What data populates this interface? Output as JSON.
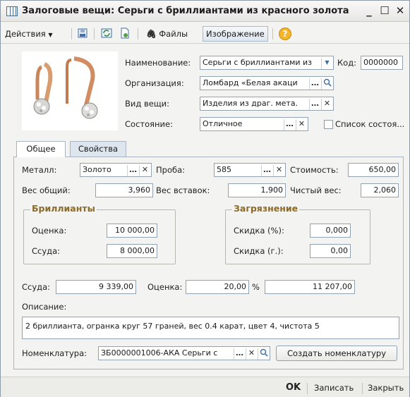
{
  "window": {
    "title": "Залоговые вещи: Серьги с бриллиантами из красного золота",
    "min_label": "_",
    "max_label": "☐",
    "close_label": "✕"
  },
  "toolbar": {
    "actions_label": "Действия",
    "files_label": "Файлы",
    "image_label": "Изображение",
    "help_label": "?"
  },
  "header": {
    "name_label": "Наименование:",
    "name_value": "Серьги с бриллиантами из",
    "code_label": "Код:",
    "code_value": "0000000",
    "org_label": "Организация:",
    "org_value": "Ломбард «Белая акаци",
    "kind_label": "Вид вещи:",
    "kind_value": "Изделия из драг. мета.",
    "state_label": "Состояние:",
    "state_value": "Отличное",
    "state_list_label": "Список состоя..."
  },
  "tabs": [
    {
      "label": "Общее"
    },
    {
      "label": "Свойства"
    }
  ],
  "general": {
    "metal_label": "Металл:",
    "metal_value": "Золото",
    "probe_label": "Проба:",
    "probe_value": "585",
    "cost_label": "Стоимость:",
    "cost_value": "650,00",
    "weight_total_label": "Вес общий:",
    "weight_total_value": "3,960",
    "weight_inserts_label": "Вес вставок:",
    "weight_inserts_value": "1,900",
    "weight_net_label": "Чистый вес:",
    "weight_net_value": "2,060"
  },
  "diamonds": {
    "title": "Бриллианты",
    "estimate_label": "Оценка:",
    "estimate_value": "10 000,00",
    "loan_label": "Ссуда:",
    "loan_value": "8 000,00"
  },
  "pollution": {
    "title": "Загрязнение",
    "discount_pct_label": "Скидка (%):",
    "discount_pct_value": "0,000",
    "discount_g_label": "Скидка (г.):",
    "discount_g_value": "0,00"
  },
  "totals": {
    "loan_label": "Ссуда:",
    "loan_value": "9 339,00",
    "estimate_label": "Оценка:",
    "estimate_pct_value": "20,00",
    "pct_sign": "%",
    "estimate_value": "11 207,00"
  },
  "description": {
    "label": "Описание:",
    "value": "2 бриллианта, огранка круг 57 граней, вес 0.4 карат, цвет 4, чистота 5"
  },
  "nomenclature": {
    "label": "Номенклатура:",
    "value": "ЗБ0000001006-АКА Серьги с",
    "create_button_label": "Создать номенклатуру"
  },
  "footer": {
    "ok_label": "OK",
    "save_label": "Записать",
    "close_label": "Закрыть"
  },
  "colors": {
    "group_title": "#8c6b2a",
    "accent_blue": "#3f6fa6"
  }
}
